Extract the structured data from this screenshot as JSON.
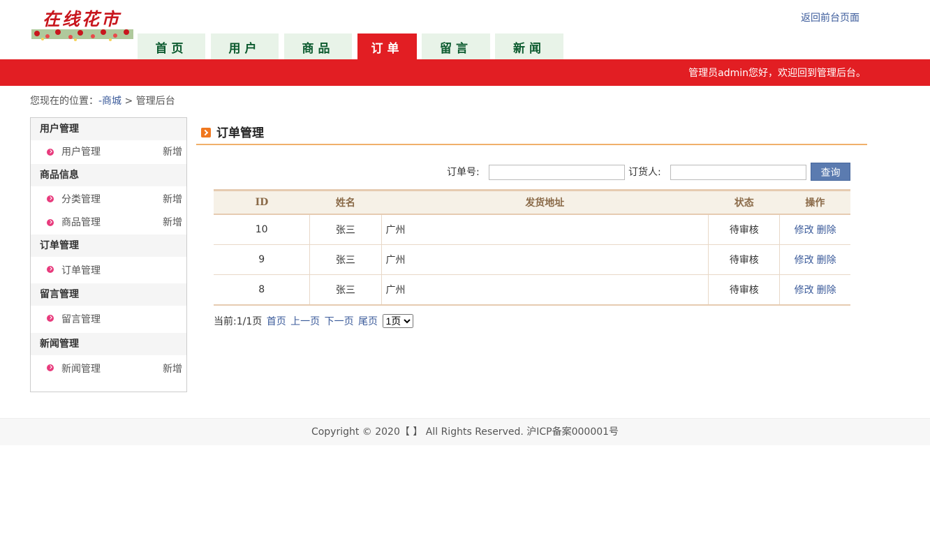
{
  "header": {
    "logo_text": "在线花市",
    "back_link": "返回前台页面",
    "nav": [
      {
        "label": "首页",
        "active": false
      },
      {
        "label": "用户",
        "active": false
      },
      {
        "label": "商品",
        "active": false
      },
      {
        "label": "订单",
        "active": true
      },
      {
        "label": "留言",
        "active": false
      },
      {
        "label": "新闻",
        "active": false
      }
    ],
    "welcome": "管理员admin您好，欢迎回到管理后台。"
  },
  "breadcrumb": {
    "prefix": "您现在的位置：",
    "link": "-商城",
    "separator": ">",
    "current": "管理后台"
  },
  "sidebar": {
    "categories": [
      {
        "title": "用户管理",
        "items": [
          {
            "label": "用户管理",
            "add": "新增"
          }
        ]
      },
      {
        "title": "商品信息",
        "items": [
          {
            "label": "分类管理",
            "add": "新增"
          },
          {
            "label": "商品管理",
            "add": "新增"
          }
        ]
      },
      {
        "title": "订单管理",
        "items": [
          {
            "label": "订单管理",
            "add": ""
          }
        ]
      },
      {
        "title": "留言管理",
        "items": [
          {
            "label": "留言管理",
            "add": ""
          }
        ]
      },
      {
        "title": "新闻管理",
        "items": [
          {
            "label": "新闻管理",
            "add": "新增"
          }
        ]
      }
    ]
  },
  "main": {
    "title": "订单管理",
    "search": {
      "order_no_label": "订单号:",
      "orderer_label": "订货人:",
      "order_no_value": "",
      "orderer_value": "",
      "button": "查询"
    },
    "table": {
      "columns": [
        "ID",
        "姓名",
        "发货地址",
        "状态",
        "操作"
      ],
      "rows": [
        {
          "id": "10",
          "name": "张三",
          "address": "广州",
          "status": "待审核",
          "edit": "修改",
          "delete": "删除"
        },
        {
          "id": "9",
          "name": "张三",
          "address": "广州",
          "status": "待审核",
          "edit": "修改",
          "delete": "删除"
        },
        {
          "id": "8",
          "name": "张三",
          "address": "广州",
          "status": "待审核",
          "edit": "修改",
          "delete": "删除"
        }
      ]
    },
    "pager": {
      "current": "当前:1/1页",
      "first": "首页",
      "prev": "上一页",
      "next": "下一页",
      "last": "尾页",
      "select_value": "1页"
    }
  },
  "footer": {
    "text": "Copyright © 2020【 】 All Rights Reserved. 沪ICP备案000001号"
  },
  "colors": {
    "brand_red": "#e21e23",
    "nav_bg": "#e8f3e8",
    "nav_text": "#0b5a2e",
    "link_blue": "#3a5a9a",
    "button_blue": "#5b7bb0",
    "accent_orange": "#f07820"
  }
}
